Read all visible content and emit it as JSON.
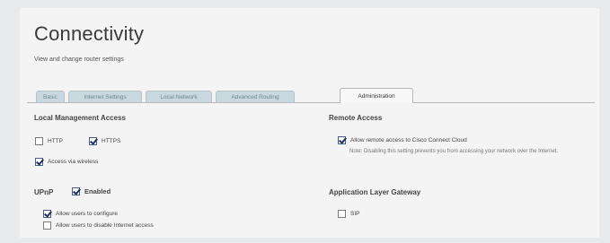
{
  "header": {
    "title": "Connectivity",
    "subtitle": "View and change router settings"
  },
  "tabs": [
    {
      "label": "Basic",
      "active": false
    },
    {
      "label": "Internet Settings",
      "active": false
    },
    {
      "label": "Local Network",
      "active": false
    },
    {
      "label": "Advanced Routing",
      "active": false
    },
    {
      "label": "Administration",
      "active": true
    }
  ],
  "local_management": {
    "heading": "Local Management Access",
    "http": {
      "label": "HTTP",
      "checked": false
    },
    "https": {
      "label": "HTTPS",
      "checked": true
    },
    "wireless": {
      "label": "Access via wireless",
      "checked": true
    }
  },
  "remote_access": {
    "heading": "Remote Access",
    "cloud": {
      "label": "Allow remote access to Cisco Connect Cloud",
      "checked": true
    },
    "note": "Note: Disabling this setting prevents you from accessing your network over the Internet."
  },
  "upnp": {
    "heading": "UPnP",
    "enabled": {
      "label": "Enabled",
      "checked": true
    },
    "configure": {
      "label": "Allow users to configure",
      "checked": true
    },
    "disable_internet": {
      "label": "Allow users to disable Internet access",
      "checked": false
    }
  },
  "alg": {
    "heading": "Application Layer Gateway",
    "sip": {
      "label": "SIP",
      "checked": false
    }
  }
}
